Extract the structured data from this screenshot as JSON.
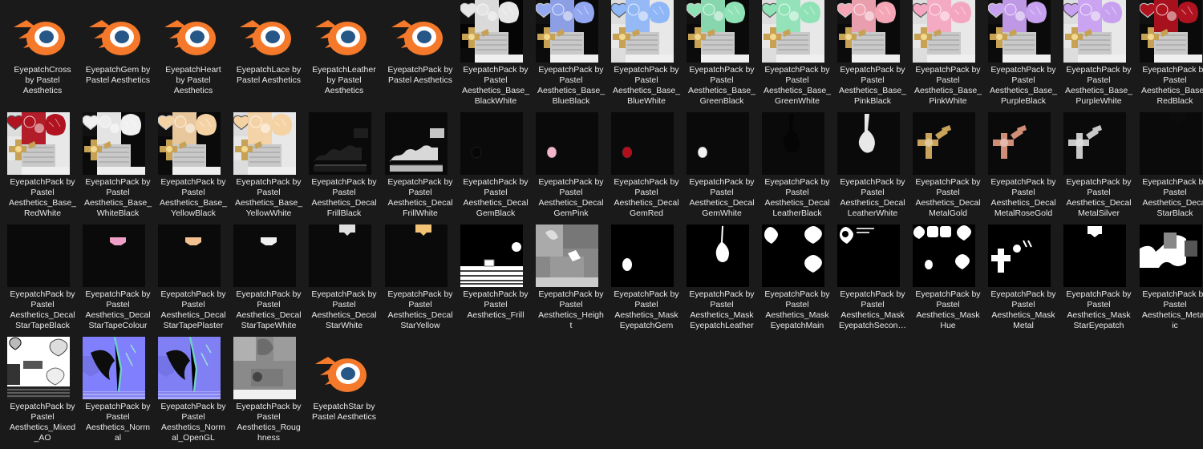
{
  "files": [
    {
      "name": "EyepatchCross by Pastel Aesthetics",
      "label": [
        "EyepatchCross",
        "by Pastel",
        "Aesthetics"
      ],
      "kind": "blender"
    },
    {
      "name": "EyepatchGem by Pastel Aesthetics",
      "label": [
        "EyepatchGem by",
        "Pastel Aesthetics"
      ],
      "kind": "blender"
    },
    {
      "name": "EyepatchHeart by Pastel Aesthetics",
      "label": [
        "EyepatchHeart",
        "by Pastel",
        "Aesthetics"
      ],
      "kind": "blender"
    },
    {
      "name": "EyepatchLace by Pastel Aesthetics",
      "label": [
        "EyepatchLace by",
        "Pastel Aesthetics"
      ],
      "kind": "blender"
    },
    {
      "name": "EyepatchLeather by Pastel Aesthetics",
      "label": [
        "EyepatchLeather",
        "by Pastel",
        "Aesthetics"
      ],
      "kind": "blender"
    },
    {
      "name": "EyepatchPack by Pastel Aesthetics",
      "label": [
        "EyepatchPack by",
        "Pastel Aesthetics"
      ],
      "kind": "blender"
    },
    {
      "name": "EyepatchPack by Pastel Aesthetics_Base_BlackWhite",
      "label": [
        "EyepatchPack by",
        "Pastel",
        "Aesthetics_Base_",
        "BlackWhite"
      ],
      "kind": "base",
      "tint": "#e6e6e6",
      "bg": "#050505"
    },
    {
      "name": "EyepatchPack by Pastel Aesthetics_Base_BlueBlack",
      "label": [
        "EyepatchPack by",
        "Pastel",
        "Aesthetics_Base_",
        "BlueBlack"
      ],
      "kind": "base",
      "tint": "#93a8f0",
      "bg": "#0a0a0a"
    },
    {
      "name": "EyepatchPack by Pastel Aesthetics_Base_BlueWhite",
      "label": [
        "EyepatchPack by",
        "Pastel",
        "Aesthetics_Base_",
        "BlueWhite"
      ],
      "kind": "base",
      "tint": "#8fb6f6",
      "bg": "#e8e8e8"
    },
    {
      "name": "EyepatchPack by Pastel Aesthetics_Base_GreenBlack",
      "label": [
        "EyepatchPack by",
        "Pastel",
        "Aesthetics_Base_",
        "GreenBlack"
      ],
      "kind": "base",
      "tint": "#8fe2b6",
      "bg": "#0a0a0a"
    },
    {
      "name": "EyepatchPack by Pastel Aesthetics_Base_GreenWhite",
      "label": [
        "EyepatchPack by",
        "Pastel",
        "Aesthetics_Base_",
        "GreenWhite"
      ],
      "kind": "base",
      "tint": "#8fe2b6",
      "bg": "#e8e8e8"
    },
    {
      "name": "EyepatchPack by Pastel Aesthetics_Base_PinkBlack",
      "label": [
        "EyepatchPack by",
        "Pastel",
        "Aesthetics_Base_",
        "PinkBlack"
      ],
      "kind": "base",
      "tint": "#f4a6b6",
      "bg": "#0a0a0a"
    },
    {
      "name": "EyepatchPack by Pastel Aesthetics_Base_PinkWhite",
      "label": [
        "EyepatchPack by",
        "Pastel",
        "Aesthetics_Base_",
        "PinkWhite"
      ],
      "kind": "base",
      "tint": "#f4a6c0",
      "bg": "#e8e8e8"
    },
    {
      "name": "EyepatchPack by Pastel Aesthetics_Base_PurpleBlack",
      "label": [
        "EyepatchPack by",
        "Pastel",
        "Aesthetics_Base_",
        "PurpleBlack"
      ],
      "kind": "base",
      "tint": "#c8a0f0",
      "bg": "#0a0a0a"
    },
    {
      "name": "EyepatchPack by Pastel Aesthetics_Base_PurpleWhite",
      "label": [
        "EyepatchPack by",
        "Pastel",
        "Aesthetics_Base_",
        "PurpleWhite"
      ],
      "kind": "base",
      "tint": "#c8a0f0",
      "bg": "#e8e8e8"
    },
    {
      "name": "EyepatchPack by Pastel Aesthetics_Base_RedBlack",
      "label": [
        "EyepatchPack by",
        "Pastel",
        "Aesthetics_Base_",
        "RedBlack"
      ],
      "kind": "base",
      "tint": "#b0121f",
      "bg": "#0a0a0a"
    },
    {
      "name": "EyepatchPack by Pastel Aesthetics_Base_RedWhite",
      "label": [
        "EyepatchPack by",
        "Pastel",
        "Aesthetics_Base_",
        "RedWhite"
      ],
      "kind": "base",
      "tint": "#b0121f",
      "bg": "#e8e8e8"
    },
    {
      "name": "EyepatchPack by Pastel Aesthetics_Base_WhiteBlack",
      "label": [
        "EyepatchPack by",
        "Pastel",
        "Aesthetics_Base_",
        "WhiteBlack"
      ],
      "kind": "base",
      "tint": "#f0f0f0",
      "bg": "#0a0a0a"
    },
    {
      "name": "EyepatchPack by Pastel Aesthetics_Base_YellowBlack",
      "label": [
        "EyepatchPack by",
        "Pastel",
        "Aesthetics_Base_",
        "YellowBlack"
      ],
      "kind": "base",
      "tint": "#f4d2a4",
      "bg": "#0a0a0a"
    },
    {
      "name": "EyepatchPack by Pastel Aesthetics_Base_YellowWhite",
      "label": [
        "EyepatchPack by",
        "Pastel",
        "Aesthetics_Base_",
        "YellowWhite"
      ],
      "kind": "base",
      "tint": "#f4d2a4",
      "bg": "#e8e8e8"
    },
    {
      "name": "EyepatchPack by Pastel Aesthetics_DecalFrillBlack",
      "label": [
        "EyepatchPack by",
        "Pastel",
        "Aesthetics_Decal",
        "FrillBlack"
      ],
      "kind": "frill",
      "tint": "#202020"
    },
    {
      "name": "EyepatchPack by Pastel Aesthetics_DecalFrillWhite",
      "label": [
        "EyepatchPack by",
        "Pastel",
        "Aesthetics_Decal",
        "FrillWhite"
      ],
      "kind": "frill",
      "tint": "#d8d8d8"
    },
    {
      "name": "EyepatchPack by Pastel Aesthetics_DecalGemBlack",
      "label": [
        "EyepatchPack by",
        "Pastel",
        "Aesthetics_Decal",
        "GemBlack"
      ],
      "kind": "gem",
      "tint": "#060606"
    },
    {
      "name": "EyepatchPack by Pastel Aesthetics_DecalGemPink",
      "label": [
        "EyepatchPack by",
        "Pastel",
        "Aesthetics_Decal",
        "GemPink"
      ],
      "kind": "gem",
      "tint": "#f3b6c8"
    },
    {
      "name": "EyepatchPack by Pastel Aesthetics_DecalGemRed",
      "label": [
        "EyepatchPack by",
        "Pastel",
        "Aesthetics_Decal",
        "GemRed"
      ],
      "kind": "gem",
      "tint": "#b0101e"
    },
    {
      "name": "EyepatchPack by Pastel Aesthetics_DecalGemWhite",
      "label": [
        "EyepatchPack by",
        "Pastel",
        "Aesthetics_Decal",
        "GemWhite"
      ],
      "kind": "gem",
      "tint": "#f2f2f2"
    },
    {
      "name": "EyepatchPack by Pastel Aesthetics_DecalLeatherBlack",
      "label": [
        "EyepatchPack by",
        "Pastel",
        "Aesthetics_Decal",
        "LeatherBlack"
      ],
      "kind": "leather",
      "tint": "#050505"
    },
    {
      "name": "EyepatchPack by Pastel Aesthetics_DecalLeatherWhite",
      "label": [
        "EyepatchPack by",
        "Pastel",
        "Aesthetics_Decal",
        "LeatherWhite"
      ],
      "kind": "leather",
      "tint": "#e8e8e8"
    },
    {
      "name": "EyepatchPack by Pastel Aesthetics_DecalMetalGold",
      "label": [
        "EyepatchPack by",
        "Pastel",
        "Aesthetics_Decal",
        "MetalGold"
      ],
      "kind": "metal",
      "tint": "#c9a35a"
    },
    {
      "name": "EyepatchPack by Pastel Aesthetics_DecalMetalRoseGold",
      "label": [
        "EyepatchPack by",
        "Pastel",
        "Aesthetics_Decal",
        "MetalRoseGold"
      ],
      "kind": "metal",
      "tint": "#d08e78"
    },
    {
      "name": "EyepatchPack by Pastel Aesthetics_DecalMetalSilver",
      "label": [
        "EyepatchPack by",
        "Pastel",
        "Aesthetics_Decal",
        "MetalSilver"
      ],
      "kind": "metal",
      "tint": "#c8c8c8"
    },
    {
      "name": "EyepatchPack by Pastel Aesthetics_DecalStarBlack",
      "label": [
        "EyepatchPack by",
        "Pastel",
        "Aesthetics_Decal",
        "StarBlack"
      ],
      "kind": "star",
      "tint": "#0c0c0c"
    },
    {
      "name": "EyepatchPack by Pastel Aesthetics_DecalStarTapeBlack",
      "label": [
        "EyepatchPack by",
        "Pastel",
        "Aesthetics_Decal",
        "StarTapeBlack"
      ],
      "kind": "tape",
      "tint": "#0a0a0a"
    },
    {
      "name": "EyepatchPack by Pastel Aesthetics_DecalStarTapeColour",
      "label": [
        "EyepatchPack by",
        "Pastel",
        "Aesthetics_Decal",
        "StarTapeColour"
      ],
      "kind": "tape",
      "tint": "#f0a0c8"
    },
    {
      "name": "EyepatchPack by Pastel Aesthetics_DecalStarTapePlaster",
      "label": [
        "EyepatchPack by",
        "Pastel",
        "Aesthetics_Decal",
        "StarTapePlaster"
      ],
      "kind": "tape",
      "tint": "#f1c28f"
    },
    {
      "name": "EyepatchPack by Pastel Aesthetics_DecalStarTapeWhite",
      "label": [
        "EyepatchPack by",
        "Pastel",
        "Aesthetics_Decal",
        "StarTapeWhite"
      ],
      "kind": "tape",
      "tint": "#f0f0f0"
    },
    {
      "name": "EyepatchPack by Pastel Aesthetics_DecalStarWhite",
      "label": [
        "EyepatchPack by",
        "Pastel",
        "Aesthetics_Decal",
        "StarWhite"
      ],
      "kind": "star",
      "tint": "#e0e0e0"
    },
    {
      "name": "EyepatchPack by Pastel Aesthetics_DecalStarYellow",
      "label": [
        "EyepatchPack by",
        "Pastel",
        "Aesthetics_Decal",
        "StarYellow"
      ],
      "kind": "star",
      "tint": "#f3c274"
    },
    {
      "name": "EyepatchPack by Pastel Aesthetics_Frill",
      "label": [
        "EyepatchPack by",
        "Pastel",
        "Aesthetics_Frill"
      ],
      "kind": "mask-frill"
    },
    {
      "name": "EyepatchPack by Pastel Aesthetics_Height",
      "label": [
        "EyepatchPack by",
        "Pastel",
        "Aesthetics_Heigh",
        "t"
      ],
      "kind": "height"
    },
    {
      "name": "EyepatchPack by Pastel Aesthetics_MaskEyepatchGem",
      "label": [
        "EyepatchPack by",
        "Pastel",
        "Aesthetics_Mask",
        "EyepatchGem"
      ],
      "kind": "mask-gem"
    },
    {
      "name": "EyepatchPack by Pastel Aesthetics_MaskEyepatchLeather",
      "label": [
        "EyepatchPack by",
        "Pastel",
        "Aesthetics_Mask",
        "EyepatchLeather"
      ],
      "kind": "mask-leather"
    },
    {
      "name": "EyepatchPack by Pastel Aesthetics_MaskEyepatchMain",
      "label": [
        "EyepatchPack by",
        "Pastel",
        "Aesthetics_Mask",
        "EyepatchMain"
      ],
      "kind": "mask-main"
    },
    {
      "name": "EyepatchPack by Pastel Aesthetics_MaskEyepatchSecon…",
      "label": [
        "EyepatchPack by",
        "Pastel",
        "Aesthetics_Mask",
        "EyepatchSecon…"
      ],
      "kind": "mask-second"
    },
    {
      "name": "EyepatchPack by Pastel Aesthetics_MaskHue",
      "label": [
        "EyepatchPack by",
        "Pastel",
        "Aesthetics_Mask",
        "Hue"
      ],
      "kind": "mask-hue"
    },
    {
      "name": "EyepatchPack by Pastel Aesthetics_MaskMetal",
      "label": [
        "EyepatchPack by",
        "Pastel",
        "Aesthetics_Mask",
        "Metal"
      ],
      "kind": "mask-metal"
    },
    {
      "name": "EyepatchPack by Pastel Aesthetics_MaskStarEyepatch",
      "label": [
        "EyepatchPack by",
        "Pastel",
        "Aesthetics_Mask",
        "StarEyepatch"
      ],
      "kind": "mask-star"
    },
    {
      "name": "EyepatchPack by Pastel Aesthetics_Metallic",
      "label": [
        "EyepatchPack by",
        "Pastel",
        "Aesthetics_Metall",
        "ic"
      ],
      "kind": "metallic"
    },
    {
      "name": "EyepatchPack by Pastel Aesthetics_Mixed_AO",
      "label": [
        "EyepatchPack by",
        "Pastel",
        "Aesthetics_Mixed",
        "_AO"
      ],
      "kind": "ao"
    },
    {
      "name": "EyepatchPack by Pastel Aesthetics_Normal",
      "label": [
        "EyepatchPack by",
        "Pastel",
        "Aesthetics_Norm",
        "al"
      ],
      "kind": "normal"
    },
    {
      "name": "EyepatchPack by Pastel Aesthetics_Normal_OpenGL",
      "label": [
        "EyepatchPack by",
        "Pastel",
        "Aesthetics_Norm",
        "al_OpenGL"
      ],
      "kind": "normal-gl"
    },
    {
      "name": "EyepatchPack by Pastel Aesthetics_Roughness",
      "label": [
        "EyepatchPack by",
        "Pastel",
        "Aesthetics_Roug",
        "hness"
      ],
      "kind": "rough"
    },
    {
      "name": "EyepatchStar by Pastel Aesthetics",
      "label": [
        "EyepatchStar by",
        "Pastel Aesthetics"
      ],
      "kind": "blender"
    }
  ]
}
